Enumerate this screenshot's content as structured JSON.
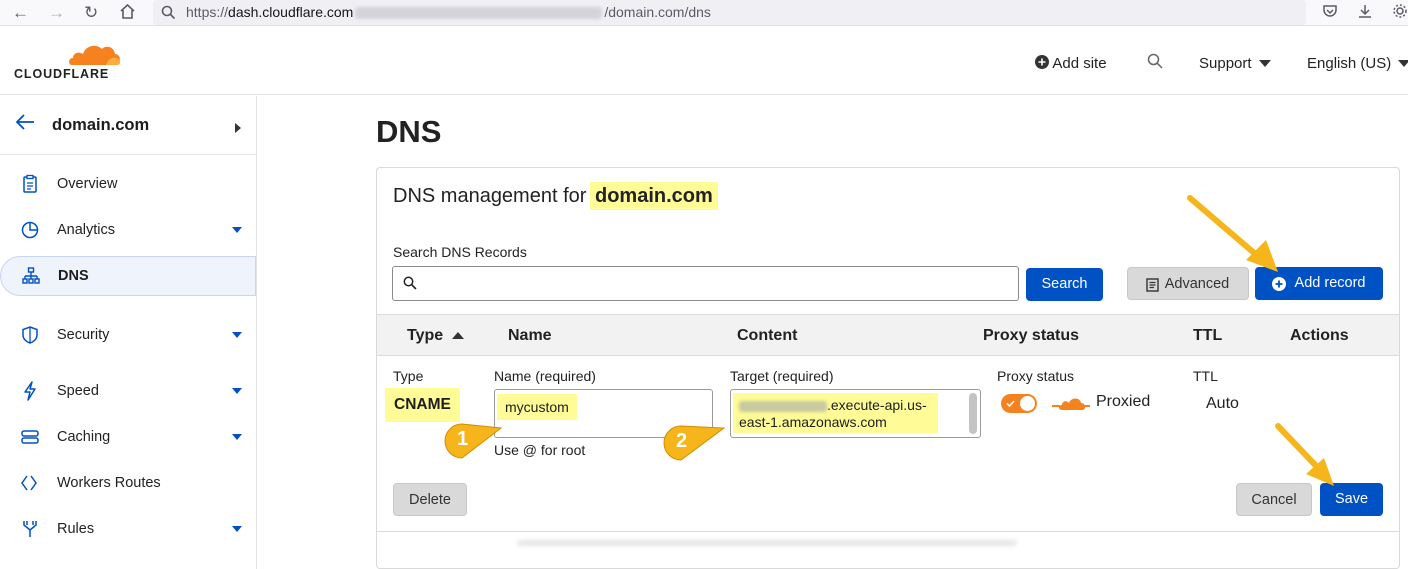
{
  "browser": {
    "url_prefix": "https://",
    "url_host": "dash.cloudflare.com",
    "url_suffix": "/domain.com/dns"
  },
  "header": {
    "logo_text": "CLOUDFLARE",
    "add_site": "Add site",
    "support": "Support",
    "language": "English (US)"
  },
  "sidebar": {
    "site_name": "domain.com",
    "items": [
      {
        "label": "Overview",
        "icon": "clipboard-icon",
        "has_caret": false
      },
      {
        "label": "Analytics",
        "icon": "pie-chart-icon",
        "has_caret": true
      },
      {
        "label": "DNS",
        "icon": "network-icon",
        "has_caret": false,
        "active": true
      },
      {
        "label": "Security",
        "icon": "shield-icon",
        "has_caret": true
      },
      {
        "label": "Speed",
        "icon": "lightning-icon",
        "has_caret": true
      },
      {
        "label": "Caching",
        "icon": "server-icon",
        "has_caret": true
      },
      {
        "label": "Workers Routes",
        "icon": "workers-icon",
        "has_caret": false
      },
      {
        "label": "Rules",
        "icon": "fork-icon",
        "has_caret": true
      }
    ]
  },
  "main": {
    "title": "DNS",
    "card": {
      "heading_prefix": "DNS management for",
      "heading_domain": "domain.com",
      "search_label": "Search DNS Records",
      "search_value": "",
      "search_button": "Search",
      "advanced_button": "Advanced",
      "add_record_button": "Add record",
      "columns": [
        "Type",
        "Name",
        "Content",
        "Proxy status",
        "TTL",
        "Actions"
      ],
      "form": {
        "type_label": "Type",
        "type_value": "CNAME",
        "name_label": "Name (required)",
        "name_value": "mycustom",
        "name_hint": "Use @ for root",
        "target_label": "Target (required)",
        "target_value_visible": ".execute-api.us-east-1.amazonaws.com",
        "target_line1": ".execute-api.us-",
        "target_line2": "east-1.amazonaws.com",
        "proxy_label": "Proxy status",
        "proxy_value": "Proxied",
        "proxy_on": true,
        "ttl_label": "TTL",
        "ttl_value": "Auto",
        "delete_button": "Delete",
        "cancel_button": "Cancel",
        "save_button": "Save"
      }
    },
    "callouts": [
      "1",
      "2"
    ]
  },
  "colors": {
    "accent_blue": "#0051c3",
    "cloudflare_orange": "#f6821f",
    "highlight_yellow": "#fffb96",
    "callout_gold": "#f5b51b"
  }
}
